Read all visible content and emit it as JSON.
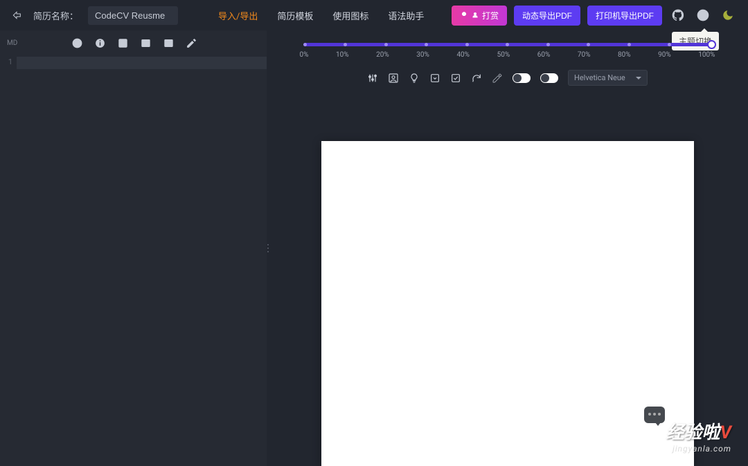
{
  "header": {
    "resume_label": "简历名称：",
    "resume_name": "CodeCV Reusme",
    "nav": {
      "import_export": "导入/导出",
      "templates": "简历模板",
      "icons": "使用图标",
      "grammar": "语法助手"
    },
    "buttons": {
      "tip": "打赏",
      "dynamic_pdf": "动态导出PDF",
      "print_pdf": "打印机导出PDF"
    },
    "tooltip": "主题切换"
  },
  "editor": {
    "mode": "MD",
    "line_number": "1"
  },
  "slider": {
    "labels": [
      "0%",
      "10%",
      "20%",
      "30%",
      "40%",
      "50%",
      "60%",
      "70%",
      "80%",
      "90%",
      "100%"
    ]
  },
  "preview": {
    "font": "Helvetica Neue"
  },
  "watermark": {
    "main_prefix": "经验啦",
    "main_accent": "V",
    "sub": "jingyanla.com"
  }
}
